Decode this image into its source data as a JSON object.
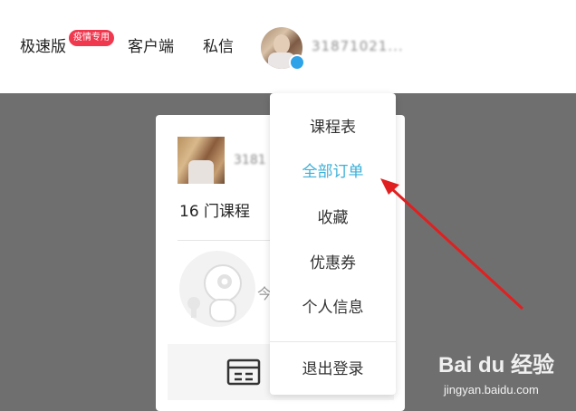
{
  "header": {
    "nav": [
      {
        "label": "极速版"
      },
      {
        "label": "客户端"
      },
      {
        "label": "私信"
      }
    ],
    "badge": "疫情专用",
    "username": "31871021..."
  },
  "card": {
    "name": "3181",
    "course_count": "16 门课程",
    "today": "今"
  },
  "dropdown": {
    "items": [
      {
        "label": "课程表"
      },
      {
        "label": "全部订单"
      },
      {
        "label": "收藏"
      },
      {
        "label": "优惠券"
      },
      {
        "label": "个人信息"
      }
    ],
    "logout": "退出登录"
  },
  "watermark": {
    "logo": "Bai du 经验",
    "sub": "jingyan.baidu.com"
  },
  "colors": {
    "accent": "#3bb0d8",
    "badge": "#f0384f",
    "annotation_arrow": "#e02020"
  }
}
